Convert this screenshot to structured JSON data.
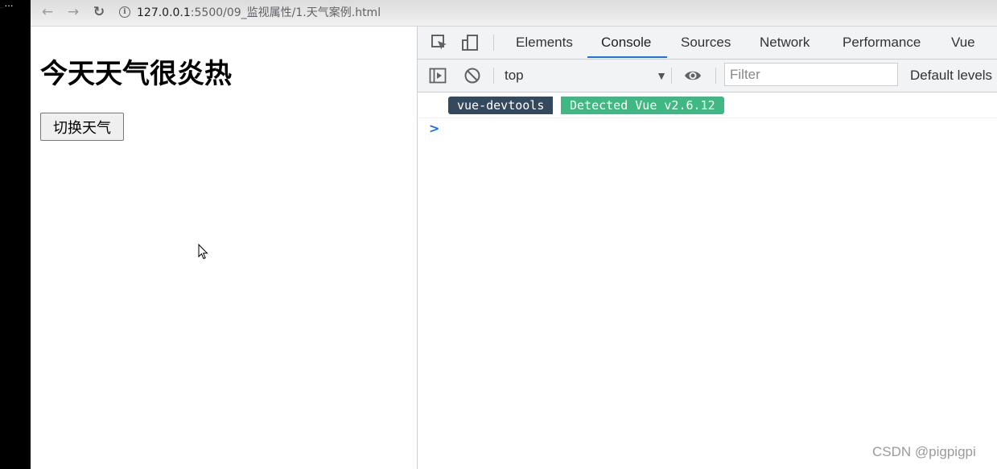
{
  "overlay_text": "_…",
  "browser": {
    "url_host": "127.0.0.1",
    "url_rest": ":5500/09_监视属性/1.天气案例.html"
  },
  "page": {
    "heading": "今天天气很炎热",
    "button_label": "切换天气"
  },
  "devtools": {
    "tabs": [
      "Elements",
      "Console",
      "Sources",
      "Network",
      "Performance",
      "Vue"
    ],
    "active_tab": "Console",
    "context": "top",
    "filter_placeholder": "Filter",
    "levels_label": "Default levels",
    "message": {
      "badge_left": "vue-devtools",
      "badge_right": "Detected Vue v2.6.12"
    },
    "prompt_symbol": ">"
  },
  "watermark": "CSDN @pigpigpi",
  "colors": {
    "vue_dark": "#35495e",
    "vue_green": "#41b883",
    "active_tab_underline": "#1a73e8"
  }
}
